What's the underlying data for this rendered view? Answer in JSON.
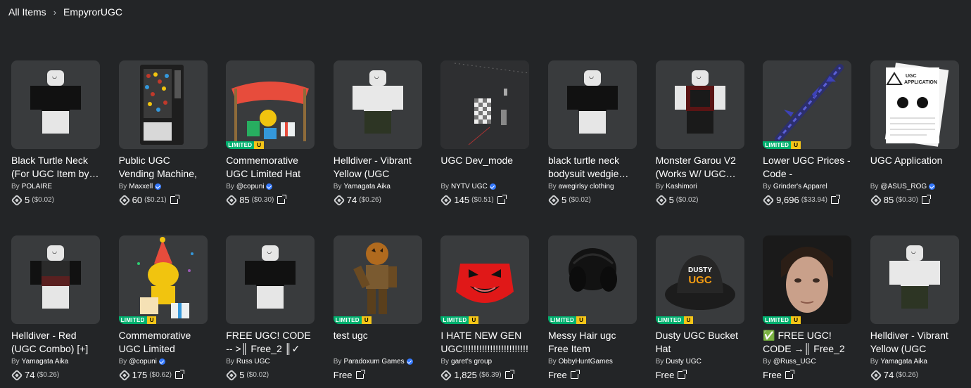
{
  "breadcrumb": {
    "root": "All Items",
    "separator": "›",
    "current": "EmpyrorUGC"
  },
  "limited_badge": {
    "text": "LIMITED",
    "u": "U"
  },
  "row1": [
    {
      "name": "Black Turtle Neck (For UGC Item by…",
      "by": "By",
      "creator": "POLAIRE",
      "verified": false,
      "price": "5",
      "usd": "($0.02)",
      "ext": false,
      "limited": false,
      "thumb": "avatar-black"
    },
    {
      "name": "Public UGC Vending Machine, \"The…",
      "by": "By",
      "creator": "Maxxell",
      "verified": true,
      "price": "60",
      "usd": "($0.21)",
      "ext": true,
      "limited": false,
      "thumb": "vending-machine"
    },
    {
      "name": "Commemorative UGC Limited Hat",
      "by": "By",
      "creator": "@copuni",
      "verified": true,
      "price": "85",
      "usd": "($0.30)",
      "ext": true,
      "limited": true,
      "thumb": "party-tent"
    },
    {
      "name": "Helldiver - Vibrant Yellow (UGC Comb…",
      "by": "By",
      "creator": "Yamagata Aika",
      "verified": false,
      "price": "74",
      "usd": "($0.26)",
      "ext": false,
      "limited": false,
      "thumb": "avatar-white"
    },
    {
      "name": "UGC Dev_mode",
      "by": "By",
      "creator": "NYTV UGC",
      "verified": true,
      "price": "145",
      "usd": "($0.51)",
      "ext": true,
      "limited": false,
      "thumb": "dev-scene"
    },
    {
      "name": "black turtle neck bodysuit wedgie…",
      "by": "By",
      "creator": "awegirlsy clothing",
      "verified": false,
      "price": "5",
      "usd": "($0.02)",
      "ext": false,
      "limited": false,
      "thumb": "avatar-black"
    },
    {
      "name": "Monster Garou V2 (Works W/ UGC…",
      "by": "By",
      "creator": "Kashimori",
      "verified": false,
      "price": "5",
      "usd": "($0.02)",
      "ext": false,
      "limited": false,
      "thumb": "avatar-red"
    },
    {
      "name": "Lower UGC Prices - Code - cheaperyayo",
      "by": "By",
      "creator": "Grinder's Apparel",
      "verified": false,
      "price": "9,696",
      "usd": "($33.94)",
      "ext": true,
      "limited": true,
      "thumb": "sword"
    },
    {
      "name": "UGC Application",
      "by": "By",
      "creator": "@ASUS_ROG",
      "verified": true,
      "price": "85",
      "usd": "($0.30)",
      "ext": true,
      "limited": false,
      "thumb": "paper"
    }
  ],
  "row2": [
    {
      "name": "Helldiver - Red (UGC Combo) [+]",
      "by": "By",
      "creator": "Yamagata Aika",
      "verified": false,
      "price": "74",
      "usd": "($0.26)",
      "ext": false,
      "limited": false,
      "thumb": "avatar-red2",
      "free": false
    },
    {
      "name": "Commemorative UGC Limited Party…",
      "by": "By",
      "creator": "@copuni",
      "verified": true,
      "price": "175",
      "usd": "($0.62)",
      "ext": true,
      "limited": true,
      "thumb": "party-noob",
      "free": false
    },
    {
      "name": "FREE UGC! CODE -- >║ Free_2 ║✓",
      "by": "By",
      "creator": "Russ UGC",
      "verified": false,
      "price": "5",
      "usd": "($0.02)",
      "ext": false,
      "limited": false,
      "thumb": "avatar-black",
      "free": false
    },
    {
      "name": "test ugc",
      "by": "By",
      "creator": "Paradoxum Games",
      "verified": true,
      "price": "Free",
      "usd": "",
      "ext": true,
      "limited": true,
      "thumb": "pumpkin",
      "free": true
    },
    {
      "name": "I HATE NEW GEN UGC!!!!!!!!!!!!!!!!!!!!!!!!!!!!!!",
      "by": "By",
      "creator": "garet's group",
      "verified": false,
      "price": "1,825",
      "usd": "($6.39)",
      "ext": true,
      "limited": true,
      "thumb": "red-mask",
      "free": false
    },
    {
      "name": "Messy Hair ugc Free Item",
      "by": "By",
      "creator": "ObbyHuntGames",
      "verified": false,
      "price": "Free",
      "usd": "",
      "ext": true,
      "limited": true,
      "thumb": "hair",
      "free": true
    },
    {
      "name": "Dusty UGC Bucket Hat",
      "by": "By",
      "creator": "Dusty UGC",
      "verified": false,
      "price": "Free",
      "usd": "",
      "ext": true,
      "limited": true,
      "thumb": "bucket-hat",
      "free": true
    },
    {
      "name": "✅ FREE UGC! CODE →║ Free_2 ║✓",
      "by": "By",
      "creator": "@Russ_UGC",
      "verified": false,
      "price": "Free",
      "usd": "",
      "ext": true,
      "limited": true,
      "thumb": "face-photo",
      "free": true
    },
    {
      "name": "Helldiver - Vibrant Yellow (UGC Comb…",
      "by": "By",
      "creator": "Yamagata Aika",
      "verified": false,
      "price": "74",
      "usd": "($0.26)",
      "ext": false,
      "limited": false,
      "thumb": "avatar-white",
      "free": false
    }
  ],
  "bucket_hat_text": "DUSTY UGC",
  "paper_text": "UGC APPLICATION"
}
